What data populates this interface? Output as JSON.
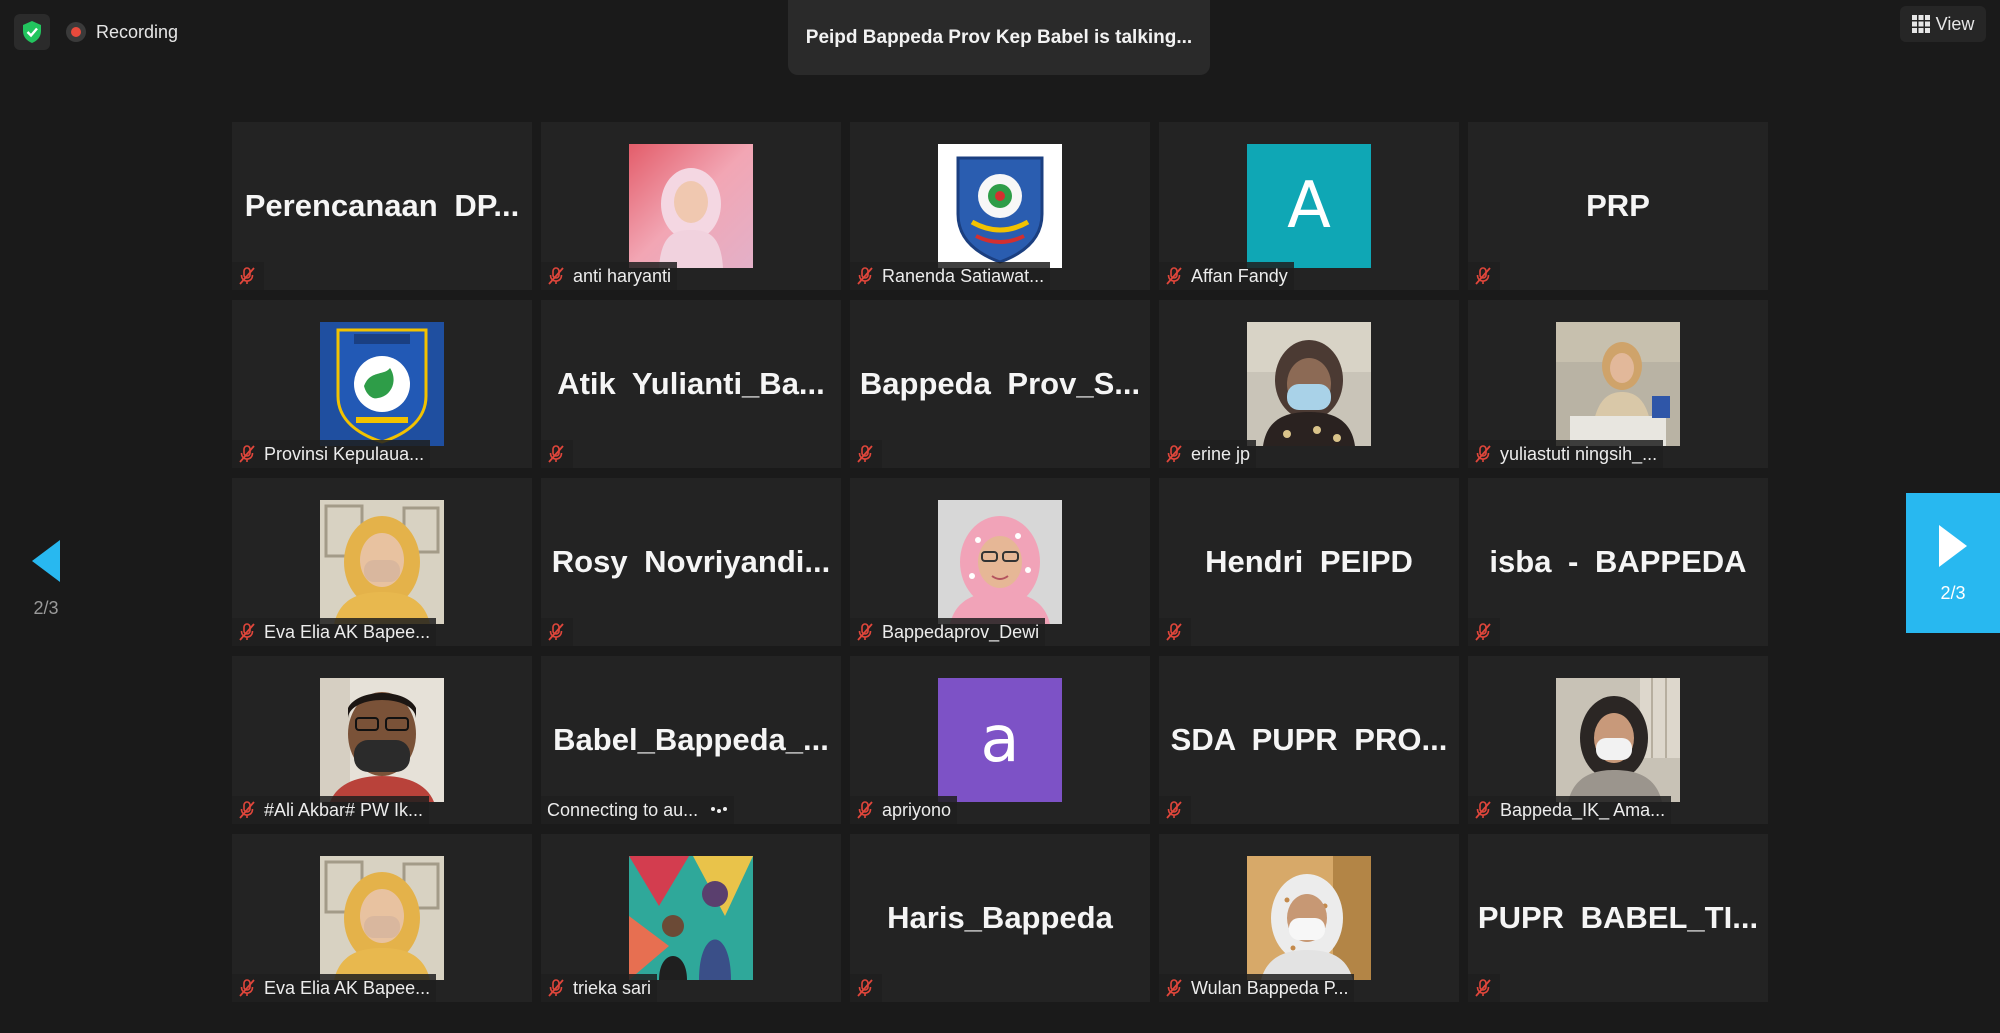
{
  "topbar": {
    "recording_label": "Recording",
    "talking_banner": "Peipd Bappeda Prov Kep Babel is talking...",
    "view_label": "View"
  },
  "colors": {
    "accent_blue": "#28b8f0",
    "recording_red": "#e84a3c",
    "shield_green": "#22c55e",
    "muted_red": "#e0463b",
    "avatar_teal": "#0fa7b5",
    "avatar_purple": "#7d52c6"
  },
  "pagination": {
    "prev_label": "2/3",
    "next_label": "2/3"
  },
  "tiles": [
    {
      "name": "Perencanaan DP...",
      "type": "text",
      "label": ""
    },
    {
      "name": "anti haryanti",
      "type": "photo",
      "photo": "woman-hijab-pink",
      "label": "anti haryanti"
    },
    {
      "name": "Ranenda Satiawat...",
      "type": "photo",
      "photo": "emblem-logo",
      "label": "Ranenda Satiawat..."
    },
    {
      "name": "Affan Fandy",
      "type": "letter",
      "letter": "A",
      "label": "Affan Fandy"
    },
    {
      "name": "PRP",
      "type": "text",
      "label": ""
    },
    {
      "name": "Provinsi Kepulaua...",
      "type": "photo",
      "photo": "province-logo",
      "label": "Provinsi Kepulaua..."
    },
    {
      "name": "Atik Yulianti_Ba...",
      "type": "text",
      "label": ""
    },
    {
      "name": "Bappeda Prov_S...",
      "type": "text",
      "label": ""
    },
    {
      "name": "erine jp",
      "type": "photo",
      "photo": "woman-mask",
      "label": "erine jp"
    },
    {
      "name": "yuliastuti ningsih_...",
      "type": "photo",
      "photo": "woman-office",
      "label": "yuliastuti ningsih_..."
    },
    {
      "name": "Eva Elia AK Bapee...",
      "type": "photo",
      "photo": "woman-mask-yellow",
      "label": "Eva Elia AK Bapee..."
    },
    {
      "name": "Rosy Novriyandi...",
      "type": "text",
      "label": ""
    },
    {
      "name": "Bappedaprov_Dewi",
      "type": "photo",
      "photo": "woman-pink-hijab",
      "label": "Bappedaprov_Dewi"
    },
    {
      "name": "Hendri PEIPD",
      "type": "text",
      "label": ""
    },
    {
      "name": "isba - BAPPEDA",
      "type": "text",
      "label": ""
    },
    {
      "name": "#Ali Akbar# PW Ik...",
      "type": "photo",
      "photo": "man-mask",
      "label": "#Ali Akbar# PW Ik..."
    },
    {
      "name": "Babel_Bappeda_...",
      "type": "text",
      "label": "Connecting to au...",
      "connecting": true
    },
    {
      "name": "apriyono",
      "type": "letter",
      "letter": "a",
      "label": "apriyono"
    },
    {
      "name": "SDA PUPR PRO...",
      "type": "text",
      "label": ""
    },
    {
      "name": "Bappeda_IK_ Ama...",
      "type": "photo",
      "photo": "woman-mask-grey",
      "label": "Bappeda_IK_ Ama..."
    },
    {
      "name": "Eva Elia AK Bapee...",
      "type": "photo",
      "photo": "woman-mask-yellow",
      "label": "Eva Elia AK Bapee..."
    },
    {
      "name": "trieka sari",
      "type": "photo",
      "photo": "family-colorful",
      "label": "trieka sari"
    },
    {
      "name": "Haris_Bappeda",
      "type": "text",
      "label": ""
    },
    {
      "name": "Wulan Bappeda P...",
      "type": "photo",
      "photo": "woman-mask-white",
      "label": "Wulan Bappeda P..."
    },
    {
      "name": "PUPR BABEL_TI...",
      "type": "text",
      "label": ""
    }
  ]
}
